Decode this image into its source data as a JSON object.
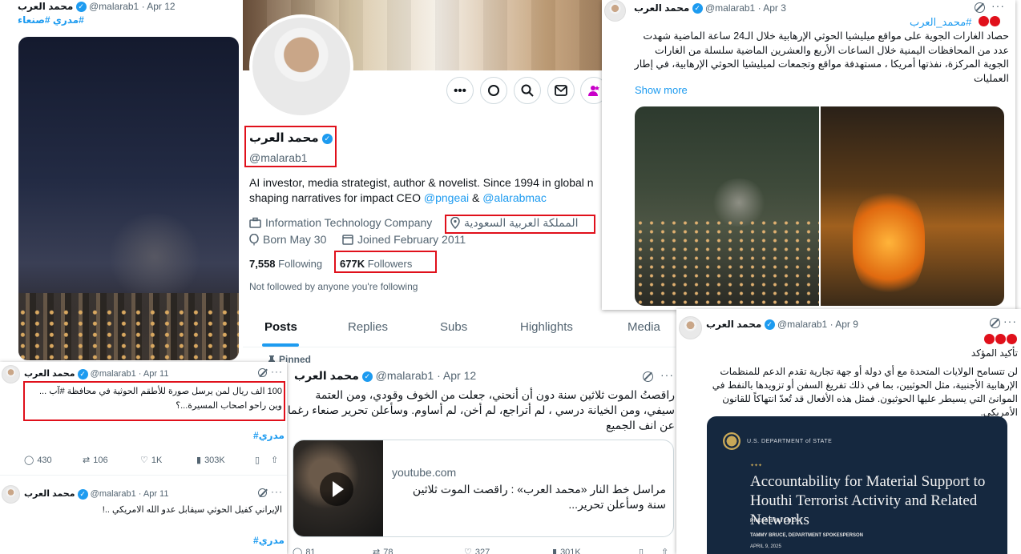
{
  "author": {
    "name": "محمد العرب",
    "handle": "@malarab1"
  },
  "left_tweet": {
    "date": "· Apr 12",
    "tags": "#مدري #صنعاء"
  },
  "profile": {
    "name": "محمد العرب",
    "handle": "@malarab1",
    "bio_line1": "AI investor, media strategist, author & novelist. Since 1994 in global n",
    "bio_line2_prefix": "shaping narratives for impact CEO ",
    "bio_mention1": "@pngeai",
    "bio_amp": " & ",
    "bio_mention2": "@alarabmac",
    "category": "Information Technology Company",
    "location": "المملكة العربية السعودية",
    "born": "Born May 30",
    "joined": "Joined February 2011",
    "following_count": "7,558",
    "following_label": "Following",
    "followers_count": "677K",
    "followers_label": "Followers",
    "not_followed": "Not followed by anyone you're following",
    "tabs": [
      "Posts",
      "Replies",
      "Subs",
      "Highlights",
      "Media"
    ],
    "pinned_label": "Pinned"
  },
  "pinned_tweet": {
    "date": "· Apr 12",
    "text": "راقصتُ الموت ثلاثين سنة دون أن أنحني، جعلت من الخوف وقودي، ومن العتمة سيفي، ومن الخيانة درسي ، لم أتراجع، لم أخن، لم أساوم. وسأعلن تحرير صنعاء رغما عن انف الجميع",
    "card_domain": "youtube.com",
    "card_title": "مراسل خط النار «محمد العرب» : راقصت الموت ثلاثين سنة وسأعلن تحرير...",
    "stats": [
      "81",
      "78",
      "327",
      "301K"
    ]
  },
  "apr11_tweet": {
    "date": "· Apr 11",
    "text": "100 الف ريال لمن يرسل صورة للأطقم الحوثية في محافظة #آب ... وين راحو اصحاب المسيرة...؟",
    "tag": "#مدري",
    "stats": [
      "430",
      "106",
      "1K",
      "303K"
    ]
  },
  "apr11_tweet2": {
    "date": "· Apr 11",
    "text": "الإيراني كفيل الحوثي سيقابل عدو الله الامريكي ..!",
    "tag": "#مدري"
  },
  "apr3_tweet": {
    "date": "· Apr 3",
    "hashtag": "#محمد_العرب",
    "text": "حصاد الغارات الجوية على مواقع ميليشيا الحوثي الإرهابية خلال الـ24 ساعة الماضية شهدت عدد من المحافظات اليمنية خلال الساعات الأربع والعشرين الماضية سلسلة من الغارات الجوية المركزة، نفذتها أمريكا ، مستهدفة مواقع وتجمعات لميليشيا الحوثي الإرهابية، في إطار العمليات",
    "show_more": "Show more"
  },
  "apr9_tweet": {
    "date": "· Apr 9",
    "text1": "تأكيد المؤكد",
    "text2": "لن تتسامح الولايات المتحدة مع أي دولة أو جهة تجارية تقدم الدعم للمنظمات الإرهابية الأجنبية، مثل الحوثيين، بما في ذلك تفريغ السفن أو تزويدها بالنفط في الموانئ التي يسيطر عليها الحوثيون. فمثل هذه الأفعال قد تُعدّ انتهاكاً للقانون الأمريكي.",
    "doc_dept": "U.S. DEPARTMENT of STATE",
    "doc_title": "Accountability for Material Support to Houthi Terrorist Activity and Related Networks",
    "doc_type": "PRESS STATEMENT",
    "doc_by": "TAMMY BRUCE, DEPARTMENT SPOKESPERSON",
    "doc_date": "APRIL 9, 2025"
  },
  "colors": {
    "accent": "#1d9bf0",
    "highlight_box": "#e0101b"
  },
  "icons": [
    "verified-badge-icon",
    "grok-icon",
    "more-icon",
    "search-icon",
    "message-icon",
    "subscribe-icon",
    "briefcase-icon",
    "location-icon",
    "balloon-icon",
    "calendar-icon",
    "reply-icon",
    "retweet-icon",
    "like-icon",
    "views-icon",
    "bookmark-icon",
    "share-icon",
    "play-icon",
    "pin-icon"
  ]
}
